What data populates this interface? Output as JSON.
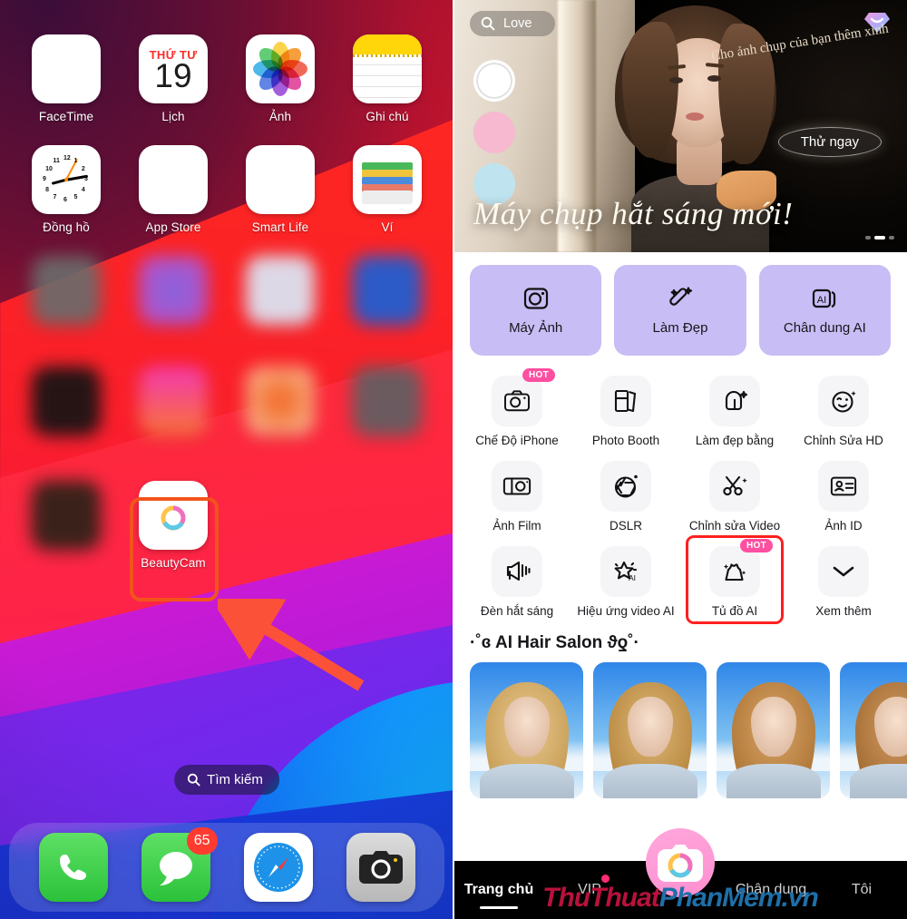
{
  "left_panel": {
    "name": "ios-home-screen",
    "rows": [
      {
        "apps": [
          {
            "label": "FaceTime",
            "icon": "facetime-icon"
          },
          {
            "label": "Lịch",
            "icon": "calendar-icon",
            "day_of_week": "THỨ TƯ",
            "day_number": "19"
          },
          {
            "label": "Ảnh",
            "icon": "photos-icon"
          },
          {
            "label": "Ghi chú",
            "icon": "notes-icon"
          }
        ]
      },
      {
        "apps": [
          {
            "label": "Đồng hồ",
            "icon": "clock-icon"
          },
          {
            "label": "App Store",
            "icon": "app-store-icon"
          },
          {
            "label": "Smart Life",
            "icon": "smart-life-icon"
          },
          {
            "label": "Ví",
            "icon": "wallet-icon"
          }
        ]
      }
    ],
    "beautycam": {
      "label": "BeautyCam",
      "icon": "beautycam-icon",
      "highlighted": true
    },
    "search": {
      "label": "Tìm kiếm",
      "icon": "search-icon"
    },
    "dock": [
      {
        "label": "Phone",
        "icon": "phone-icon",
        "badge": ""
      },
      {
        "label": "Messages",
        "icon": "messages-icon",
        "badge": "65"
      },
      {
        "label": "Safari",
        "icon": "safari-icon",
        "badge": ""
      },
      {
        "label": "Camera",
        "icon": "camera-icon",
        "badge": ""
      }
    ],
    "annotation": {
      "arrow": "red-arrow-pointing-to-beautycam",
      "color": "#f2541b"
    }
  },
  "right_panel": {
    "name": "beautycam-app",
    "banner": {
      "search_value": "Love",
      "search_icon": "search-icon",
      "vip_icon": "diamond-icon",
      "caption": "Cho ảnh chụp của bạn thêm xinh",
      "cta_label": "Thử ngay",
      "headline": "Máy chụp hắt sáng mới!",
      "swatches": [
        "#ffffff",
        "#f6b9d0",
        "#bfe4ef"
      ],
      "page_dots": 3,
      "active_dot": 2
    },
    "quick_actions": [
      {
        "label": "Máy Ảnh",
        "icon": "camera-square-icon"
      },
      {
        "label": "Làm Đẹp",
        "icon": "magic-wand-icon"
      },
      {
        "label": "Chân dung AI",
        "icon": "ai-portrait-icon"
      }
    ],
    "quick_action_color": "#c9bdf5",
    "grid": [
      [
        {
          "label": "Chế Độ iPhone",
          "icon": "camera-icon",
          "badge": "HOT"
        },
        {
          "label": "Photo Booth",
          "icon": "photo-booth-icon",
          "badge": ""
        },
        {
          "label": "Làm đẹp bằng",
          "icon": "beauty-ai-icon",
          "badge": ""
        },
        {
          "label": "Chỉnh Sửa HD",
          "icon": "wink-face-icon",
          "badge": ""
        }
      ],
      [
        {
          "label": "Ảnh Film",
          "icon": "film-camera-icon",
          "badge": ""
        },
        {
          "label": "DSLR",
          "icon": "aperture-icon",
          "badge": ""
        },
        {
          "label": "Chỉnh sửa Video",
          "icon": "scissors-icon",
          "badge": ""
        },
        {
          "label": "Ảnh ID",
          "icon": "id-card-icon",
          "badge": ""
        }
      ],
      [
        {
          "label": "Đèn hắt sáng",
          "icon": "spotlight-icon",
          "badge": ""
        },
        {
          "label": "Hiệu ứng video AI",
          "icon": "ai-sparkle-icon",
          "badge": ""
        },
        {
          "label": "Tủ đồ AI",
          "icon": "dress-icon",
          "badge": "HOT",
          "highlighted": true
        },
        {
          "label": "Xem thêm",
          "icon": "chevron-down-icon",
          "badge": ""
        }
      ]
    ],
    "section": {
      "title": "·˚ɞ AI Hair Salon ϑƍ˚·",
      "thumbnails": 4
    },
    "tabbar": [
      {
        "label": "Trang chủ",
        "active": true,
        "dot": false
      },
      {
        "label": "VIP",
        "active": false,
        "dot": true
      },
      {
        "label": "Chân dung",
        "active": false,
        "dot": false
      },
      {
        "label": "Tôi",
        "active": false,
        "dot": false
      }
    ],
    "fab": {
      "icon": "beautycam-icon"
    },
    "watermark": {
      "part1": "ThuThuat",
      "part2": "PhanMem.vn"
    },
    "annotation": {
      "arrow": "red-arrow-pointing-to-tu-do-ai",
      "color": "#ff2d1f"
    }
  }
}
